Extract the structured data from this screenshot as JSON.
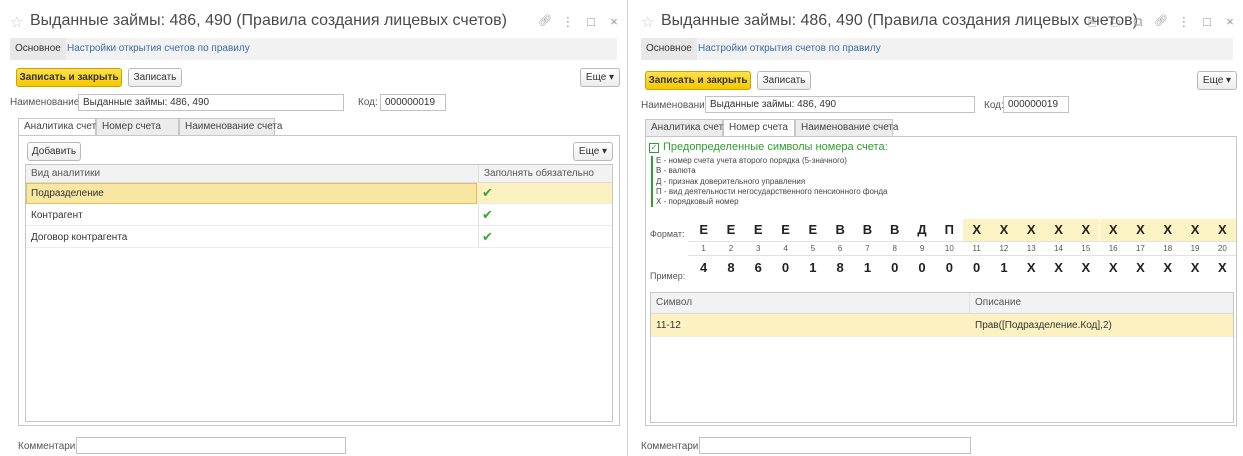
{
  "left": {
    "title": "Выданные займы: 486, 490 (Правила создания лицевых счетов)",
    "sections": [
      "Основное",
      "Настройки открытия счетов по правилу"
    ],
    "toolbar": {
      "save_close": "Записать и закрыть",
      "save": "Записать",
      "more": "Еще ▾"
    },
    "name_label": "Наименование:",
    "name_value": "Выданные займы: 486, 490",
    "code_label": "Код:",
    "code_value": "000000019",
    "tabs": [
      "Аналитика счета",
      "Номер счета",
      "Наименование счета"
    ],
    "add_button": "Добавить",
    "more2": "Еще ▾",
    "columns": [
      "Вид аналитики",
      "Заполнять обязательно"
    ],
    "rows": [
      {
        "name": "Подразделение",
        "required": "✔"
      },
      {
        "name": "Контрагент",
        "required": "✔"
      },
      {
        "name": "Договор контрагента",
        "required": "✔"
      }
    ],
    "comment_label": "Комментарий:"
  },
  "right": {
    "title": "Выданные займы: 486, 490 (Правила создания лицевых счетов)",
    "sections": [
      "Основное",
      "Настройки открытия счетов по правилу"
    ],
    "toolbar": {
      "save_close": "Записать и закрыть",
      "save": "Записать",
      "more": "Еще ▾"
    },
    "name_label": "Наименование:",
    "name_value": "Выданные займы: 486, 490",
    "code_label": "Код:",
    "code_value": "000000019",
    "tabs": [
      "Аналитика счета",
      "Номер счета",
      "Наименование счета"
    ],
    "predef_heading": "Предопределенные символы номера счета:",
    "predef_check": "✓",
    "legend": [
      "Е - номер счета учета второго порядка (5-значного)",
      "В - валюта",
      "Д - признак доверительного управления",
      "П - вид деятельности негосударственного пенсионного фонда",
      "Х - порядковый номер"
    ],
    "format_label": "Формат:",
    "example_label": "Пример:",
    "format": [
      "Е",
      "Е",
      "Е",
      "Е",
      "Е",
      "В",
      "В",
      "В",
      "Д",
      "П",
      "Х",
      "Х",
      "Х",
      "Х",
      "Х",
      "Х",
      "Х",
      "Х",
      "Х",
      "Х"
    ],
    "indexes": [
      "1",
      "2",
      "3",
      "4",
      "5",
      "6",
      "7",
      "8",
      "9",
      "10",
      "11",
      "12",
      "13",
      "14",
      "15",
      "16",
      "17",
      "18",
      "19",
      "20"
    ],
    "example": [
      "4",
      "8",
      "6",
      "0",
      "1",
      "8",
      "1",
      "0",
      "0",
      "0",
      "0",
      "1",
      "Х",
      "Х",
      "Х",
      "Х",
      "Х",
      "Х",
      "Х",
      "Х"
    ],
    "columns": [
      "Символ",
      "Описание"
    ],
    "rows": [
      {
        "symbol": "11-12",
        "description": "Прав([Подразделение.Код],2)"
      }
    ],
    "comment_label": "Комментарий:"
  },
  "icons": {
    "star": "☆",
    "link": "🔗",
    "menu": "⋮",
    "maximize": "□",
    "close": "×",
    "save_doc": "🗎",
    "print": "⎙",
    "preview": "⧉"
  }
}
